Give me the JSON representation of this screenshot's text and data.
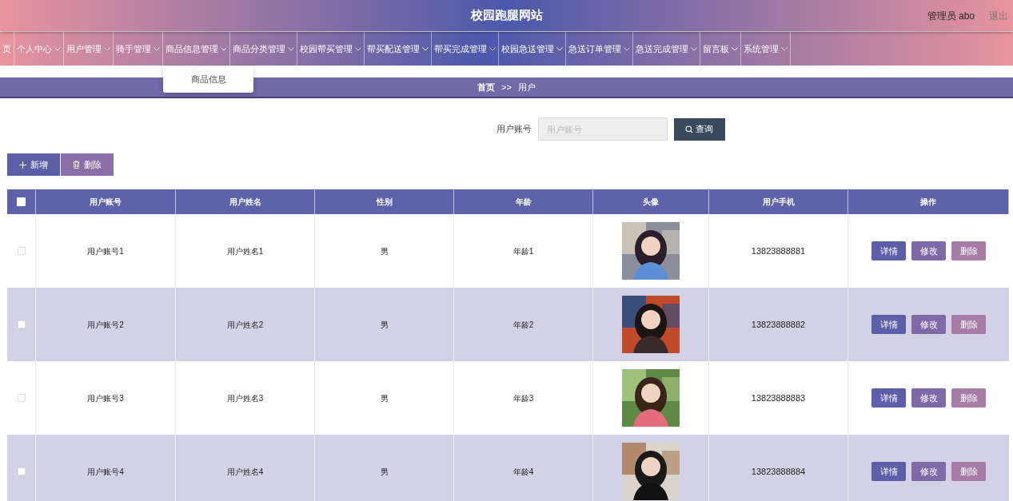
{
  "header": {
    "title": "校园跑腿网站",
    "user": "管理员 abo",
    "logout": "退出"
  },
  "nav": [
    {
      "label": "页",
      "caret": false
    },
    {
      "label": "个人中心",
      "caret": true
    },
    {
      "label": "用户管理",
      "caret": true
    },
    {
      "label": "骑手管理",
      "caret": true
    },
    {
      "label": "商品信息管理",
      "caret": true,
      "menu": [
        "商品信息"
      ]
    },
    {
      "label": "商品分类管理",
      "caret": true
    },
    {
      "label": "校园帮买管理",
      "caret": true
    },
    {
      "label": "帮买配送管理",
      "caret": true
    },
    {
      "label": "帮买完成管理",
      "caret": true
    },
    {
      "label": "校园急送管理",
      "caret": true
    },
    {
      "label": "急送订单管理",
      "caret": true
    },
    {
      "label": "急送完成管理",
      "caret": true
    },
    {
      "label": "留言板",
      "caret": true
    },
    {
      "label": "系统管理",
      "caret": true
    }
  ],
  "breadcrumb": {
    "home": "首页",
    "separator": ">>",
    "current": "用户"
  },
  "search": {
    "label": "用户账号",
    "placeholder": "用户账号",
    "button": "查询"
  },
  "toolbar": [
    {
      "kind": "add",
      "label": "新增"
    },
    {
      "kind": "delete",
      "label": "删除"
    }
  ],
  "table": {
    "all_checked": false,
    "columns": [
      "用户账号",
      "用户姓名",
      "性别",
      "年龄",
      "头像",
      "用户手机",
      "操作"
    ],
    "rows": [
      {
        "checked": false,
        "account": "用户账号1",
        "name": "用户姓名1",
        "gender": "男",
        "age": "年龄1",
        "avatar": {
          "kind": "picture"
        },
        "phone": "13823888881",
        "actions": [
          "详情",
          "修改",
          "删除"
        ]
      },
      {
        "checked": false,
        "account": "用户账号2",
        "name": "用户姓名2",
        "gender": "男",
        "age": "年龄2",
        "avatar": {
          "kind": "picture"
        },
        "phone": "13823888882",
        "actions": [
          "详情",
          "修改",
          "删除"
        ]
      },
      {
        "checked": false,
        "account": "用户账号3",
        "name": "用户姓名3",
        "gender": "男",
        "age": "年龄3",
        "avatar": {
          "kind": "picture"
        },
        "phone": "13823888883",
        "actions": [
          "详情",
          "修改",
          "删除"
        ]
      },
      {
        "checked": false,
        "account": "用户账号4",
        "name": "用户姓名4",
        "gender": "男",
        "age": "年龄4",
        "avatar": {
          "kind": "picture"
        },
        "phone": "13823888884",
        "actions": [
          "详情",
          "修改",
          "删除"
        ]
      }
    ]
  }
}
